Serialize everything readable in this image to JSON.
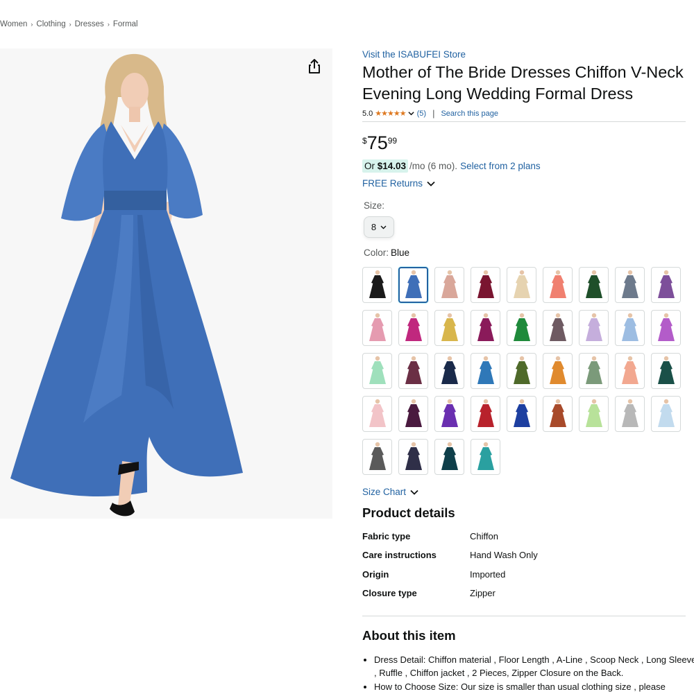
{
  "breadcrumb": [
    "Women",
    "Clothing",
    "Dresses",
    "Formal"
  ],
  "icons": {
    "share": "share-icon",
    "chevron": "chevron-down-icon",
    "star": "star-icon"
  },
  "product": {
    "store_link": "Visit the ISABUFEI Store",
    "title": "Mother of The Bride Dresses Chiffon V-Neck Evening Long Wedding Formal Dress",
    "rating_value": "5.0",
    "rating_stars": "★★★★★",
    "rating_count": "(5)",
    "search_page": "Search this page",
    "price": {
      "symbol": "$",
      "whole": "75",
      "fraction": "99"
    },
    "installment": {
      "prefix": "Or ",
      "amount": "$14.03",
      "suffix": "/mo (6 mo).",
      "plans_link": "Select from 2 plans"
    },
    "returns": "FREE Returns",
    "size_label": "Size:",
    "size_value": "8",
    "color_label": "Color:",
    "color_value": "Blue",
    "size_chart": "Size Chart"
  },
  "swatches": [
    {
      "color": "#1a1a1a",
      "selected": false
    },
    {
      "color": "#3f6fb8",
      "selected": true
    },
    {
      "color": "#d9a79a",
      "selected": false
    },
    {
      "color": "#7a1530",
      "selected": false
    },
    {
      "color": "#e6d3b0",
      "selected": false
    },
    {
      "color": "#f08070",
      "selected": false
    },
    {
      "color": "#1f4f2a",
      "selected": false
    },
    {
      "color": "#6d7a8c",
      "selected": false
    },
    {
      "color": "#7d4f9a",
      "selected": false
    },
    {
      "color": "#e59bb0",
      "selected": false
    },
    {
      "color": "#c0287e",
      "selected": false
    },
    {
      "color": "#d8b64c",
      "selected": false
    },
    {
      "color": "#8a1a5a",
      "selected": false
    },
    {
      "color": "#1f8a3b",
      "selected": false
    },
    {
      "color": "#6e5a62",
      "selected": false
    },
    {
      "color": "#c5aedc",
      "selected": false
    },
    {
      "color": "#9dbde2",
      "selected": false
    },
    {
      "color": "#b35cc9",
      "selected": false
    },
    {
      "color": "#9fe0bc",
      "selected": false
    },
    {
      "color": "#6b2f45",
      "selected": false
    },
    {
      "color": "#1a2a4a",
      "selected": false
    },
    {
      "color": "#2f78b8",
      "selected": false
    },
    {
      "color": "#4f6a2a",
      "selected": false
    },
    {
      "color": "#e08a2e",
      "selected": false
    },
    {
      "color": "#7b9a7a",
      "selected": false
    },
    {
      "color": "#f2a890",
      "selected": false
    },
    {
      "color": "#1a5048",
      "selected": false
    },
    {
      "color": "#f2c4c8",
      "selected": false
    },
    {
      "color": "#4a1a3f",
      "selected": false
    },
    {
      "color": "#6a2fb0",
      "selected": false
    },
    {
      "color": "#b8222c",
      "selected": false
    },
    {
      "color": "#1d3fa0",
      "selected": false
    },
    {
      "color": "#a84a2a",
      "selected": false
    },
    {
      "color": "#b8e29a",
      "selected": false
    },
    {
      "color": "#b8b8b8",
      "selected": false
    },
    {
      "color": "#c2dbee",
      "selected": false
    },
    {
      "color": "#5a5a5a",
      "selected": false
    },
    {
      "color": "#2f2f48",
      "selected": false
    },
    {
      "color": "#0f3f4a",
      "selected": false
    },
    {
      "color": "#2aa0a0",
      "selected": false
    }
  ],
  "details": {
    "heading": "Product details",
    "rows": [
      {
        "key": "Fabric type",
        "value": "Chiffon"
      },
      {
        "key": "Care instructions",
        "value": "Hand Wash Only"
      },
      {
        "key": "Origin",
        "value": "Imported"
      },
      {
        "key": "Closure type",
        "value": "Zipper"
      }
    ]
  },
  "about": {
    "heading": "About this item",
    "bullets": [
      "Dress Detail: Chiffon material , Floor Length , A-Line , Scoop Neck , Long Sleeve , Ruffle , Chiffon jacket , 2 Pieces, Zipper Closure on the Back.",
      "How to Choose Size: Our size is smaller than usual clothing size , please"
    ]
  },
  "colors": {
    "link": "#2162a1",
    "star": "#de7921",
    "dress": "#3f6fb8",
    "highlight": "#d7f3ec"
  }
}
